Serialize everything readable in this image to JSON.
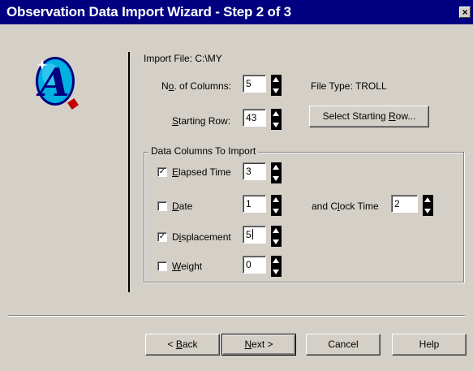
{
  "window": {
    "title": "Observation Data Import Wizard - Step 2 of 3",
    "close_label": "×"
  },
  "logo": {
    "letter": "A"
  },
  "import": {
    "file_label": "Import File:",
    "file_value": "C:\\MY",
    "columns_label_pre": "N",
    "columns_label_acc": "o",
    "columns_label_post": ". of Columns:",
    "columns_value": "5",
    "starting_row_label_pre": "",
    "starting_row_label_acc": "S",
    "starting_row_label_post": "tarting Row:",
    "starting_row_value": "43",
    "file_type_label": "File Type:",
    "file_type_value": "TROLL",
    "select_row_button_pre": "Select Starting ",
    "select_row_button_acc": "R",
    "select_row_button_post": "ow..."
  },
  "columns_group": {
    "title": "Data Columns To Import",
    "items": [
      {
        "checked": true,
        "mark": "✓",
        "pre": "",
        "acc": "E",
        "post": "lapsed Time",
        "value": "3"
      },
      {
        "checked": false,
        "mark": "",
        "pre": "",
        "acc": "D",
        "post": "ate",
        "value": "1"
      },
      {
        "checked": true,
        "mark": "✓",
        "pre": "D",
        "acc": "i",
        "post": "splacement",
        "value": "5"
      },
      {
        "checked": false,
        "mark": "",
        "pre": "",
        "acc": "W",
        "post": "eight",
        "value": "0"
      }
    ],
    "clock_time_pre": "and C",
    "clock_time_acc": "l",
    "clock_time_post": "ock Time",
    "clock_time_value": "2"
  },
  "footer": {
    "back_pre": "< ",
    "back_acc": "B",
    "back_post": "ack",
    "next_pre": "",
    "next_acc": "N",
    "next_post": "ext >",
    "cancel_label": "Cancel",
    "help_label": "Help"
  }
}
